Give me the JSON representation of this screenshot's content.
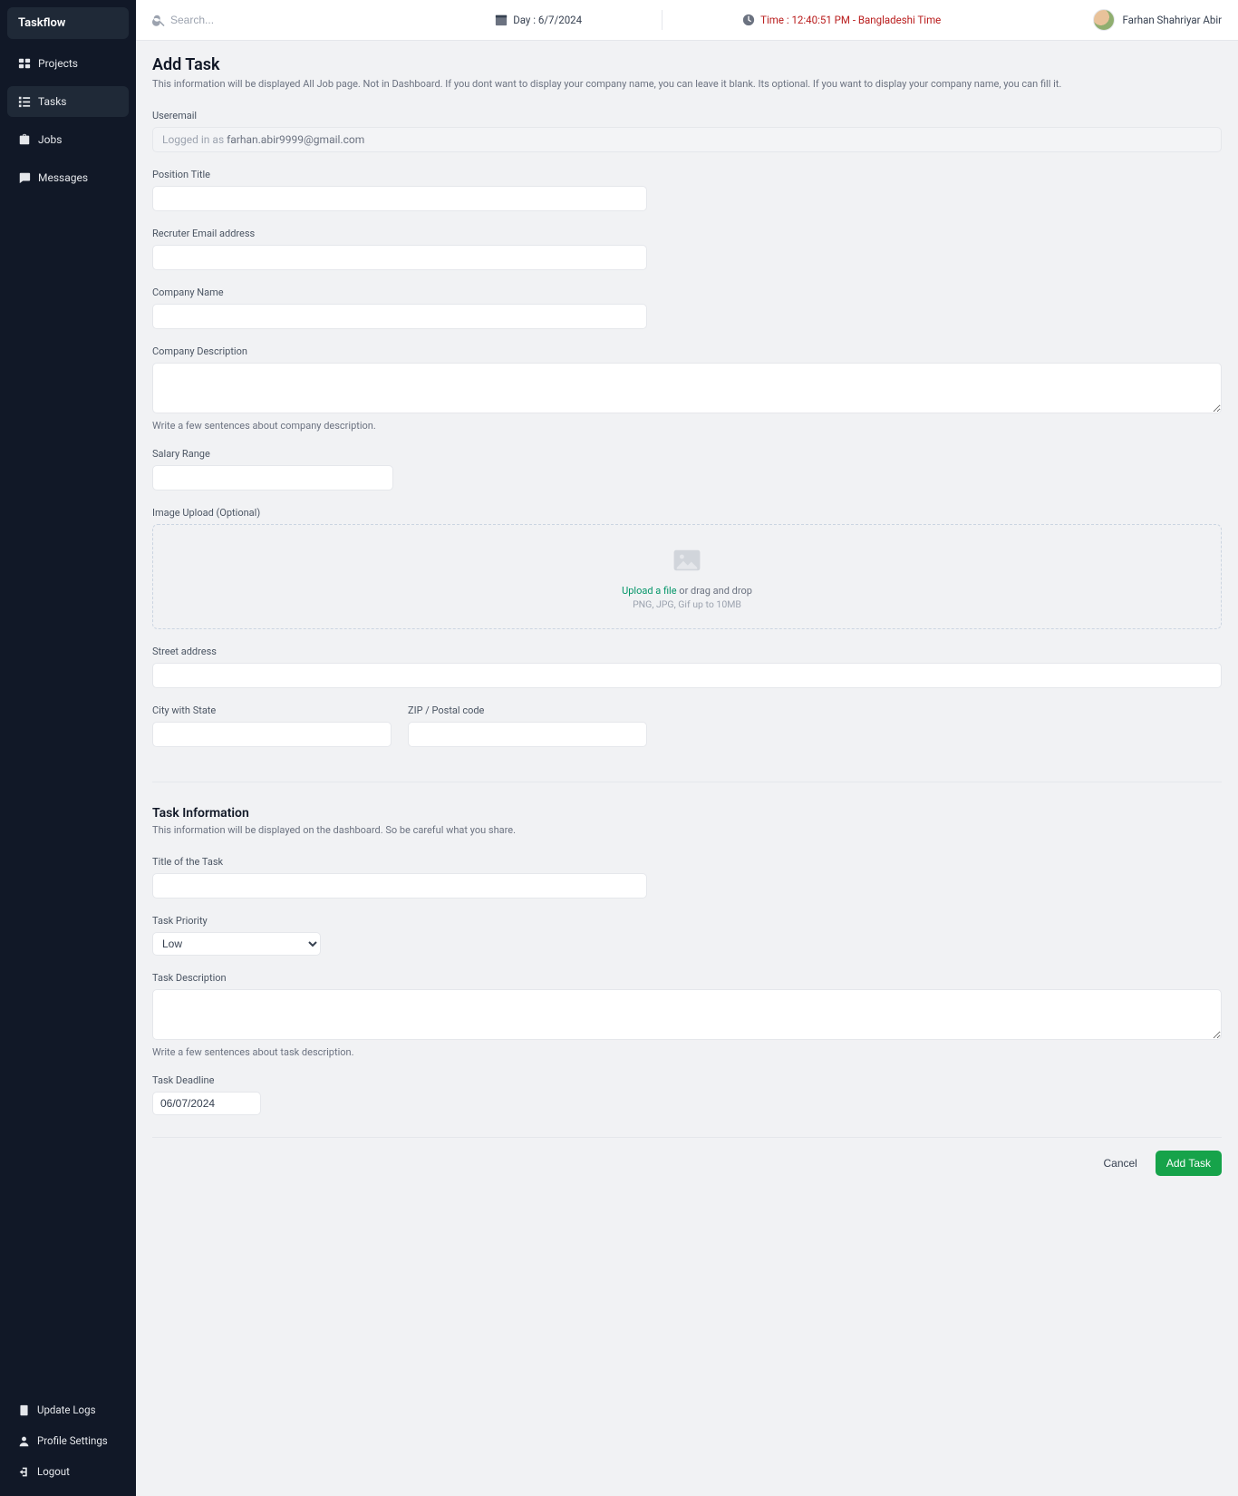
{
  "brand": "Taskflow",
  "sidebar": {
    "items": [
      {
        "label": "Projects",
        "icon": "projects"
      },
      {
        "label": "Tasks",
        "icon": "tasks",
        "active": true
      },
      {
        "label": "Jobs",
        "icon": "briefcase"
      },
      {
        "label": "Messages",
        "icon": "chat"
      }
    ],
    "bottom": [
      {
        "label": "Update Logs",
        "icon": "clipboard"
      },
      {
        "label": "Profile Settings",
        "icon": "user"
      },
      {
        "label": "Logout",
        "icon": "logout"
      }
    ]
  },
  "topbar": {
    "search_placeholder": "Search...",
    "day_prefix": "Day : ",
    "day_value": "6/7/2024",
    "time_prefix": "Time : ",
    "time_value": "12:40:51 PM - Bangladeshi Time",
    "username": "Farhan Shahriyar Abir"
  },
  "page": {
    "title": "Add Task",
    "subtitle": "This information will be displayed All Job page. Not in Dashboard. If you dont want to display your company name, you can leave it blank. Its optional. If you want to display your company name, you can fill it."
  },
  "form": {
    "useremail_label": "Useremail",
    "useremail_prefix": "Logged in as ",
    "useremail_value": "farhan.abir9999@gmail.com",
    "position_label": "Position Title",
    "recruiter_label": "Recruter Email address",
    "company_name_label": "Company Name",
    "company_desc_label": "Company Description",
    "company_desc_helper": "Write a few sentences about company description.",
    "salary_label": "Salary Range",
    "image_label": "Image Upload (Optional)",
    "upload_link_text": "Upload a file",
    "upload_rest_text": " or drag and drop",
    "upload_hint": "PNG, JPG, Gif up to 10MB",
    "street_label": "Street address",
    "city_label": "City with State",
    "zip_label": "ZIP / Postal code"
  },
  "task_section": {
    "title": "Task Information",
    "subtitle": "This information will be displayed on the dashboard. So be careful what you share.",
    "title_label": "Title of the Task",
    "priority_label": "Task Priority",
    "priority_value": "Low",
    "description_label": "Task Description",
    "description_helper": "Write a few sentences about task description.",
    "deadline_label": "Task Deadline",
    "deadline_value": "06/07/2024"
  },
  "actions": {
    "cancel": "Cancel",
    "submit": "Add Task"
  }
}
